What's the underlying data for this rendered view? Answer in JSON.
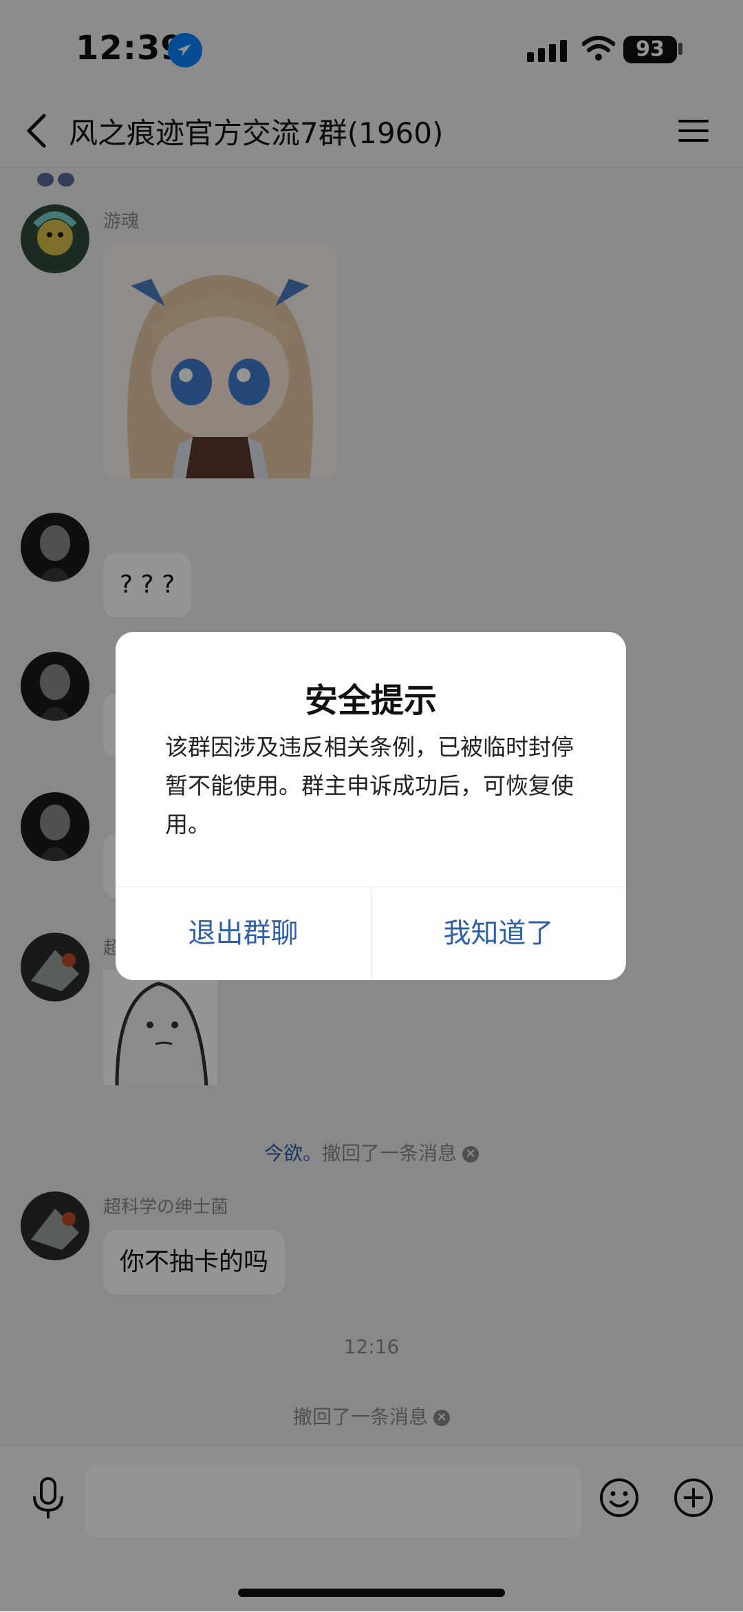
{
  "status_bar": {
    "time": "12:39",
    "battery": "93"
  },
  "nav": {
    "title": "风之痕迹官方交流7群(1960)"
  },
  "messages": {
    "m1_name": "游魂",
    "m2_text": "? ? ?",
    "m5_name_fragment": "超",
    "recall1": {
      "user": "今欲。",
      "text": "撤回了一条消息"
    },
    "m6_name": "超科学の绅士菌",
    "m6_text": "你不抽卡的吗",
    "timestamp": "12:16",
    "recall2": {
      "text": "撤回了一条消息"
    }
  },
  "dialog": {
    "title": "安全提示",
    "body": "该群因涉及违反相关条例，已被临时封停暂不能使用。群主申诉成功后，可恢复使用。",
    "exit_label": "退出群聊",
    "ok_label": "我知道了"
  },
  "colors": {
    "accent_blue": "#2f5fa6",
    "location_blue": "#0a84ff"
  }
}
